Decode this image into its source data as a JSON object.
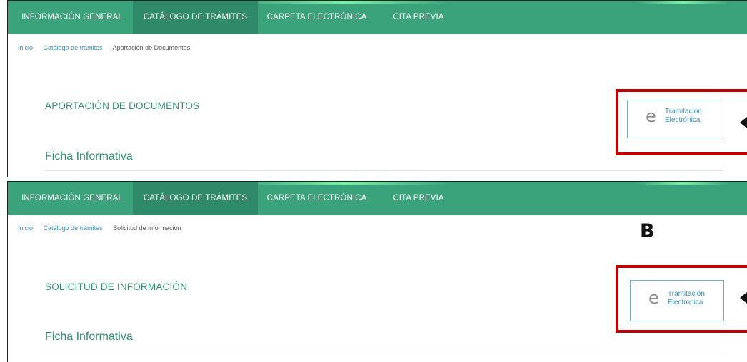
{
  "nav": {
    "items": [
      "INFORMACIÓN GENERAL",
      "CATÁLOGO DE TRÁMITES",
      "CARPETA ELECTRÓNICA",
      "CITA PREVIA"
    ],
    "active_index": 1
  },
  "panel_a": {
    "breadcrumb": {
      "home": "Inicio",
      "catalog": "Catálogo de trámites",
      "current": "Aportación de Documentos"
    },
    "page_title": "APORTACIÓN DE DOCUMENTOS",
    "section_title": "Ficha Informativa",
    "button": {
      "icon": "e-icon",
      "line1": "Tramitación",
      "line2": "Electrónica"
    }
  },
  "panel_b": {
    "label": "B",
    "breadcrumb": {
      "home": "Inicio",
      "catalog": "Catálogo de trámites",
      "current": "Solicitud de información"
    },
    "page_title": "SOLICITUD DE INFORMACIÓN",
    "section_title": "Ficha Informativa",
    "button": {
      "icon": "e-icon",
      "line1": "Tramitación",
      "line2": "Electrónica"
    }
  },
  "colors": {
    "nav": "#3aa37c",
    "nav_active": "#2f8a6a",
    "title": "#2e8f6b",
    "highlight": "#c00000",
    "link": "#3a90b8"
  }
}
